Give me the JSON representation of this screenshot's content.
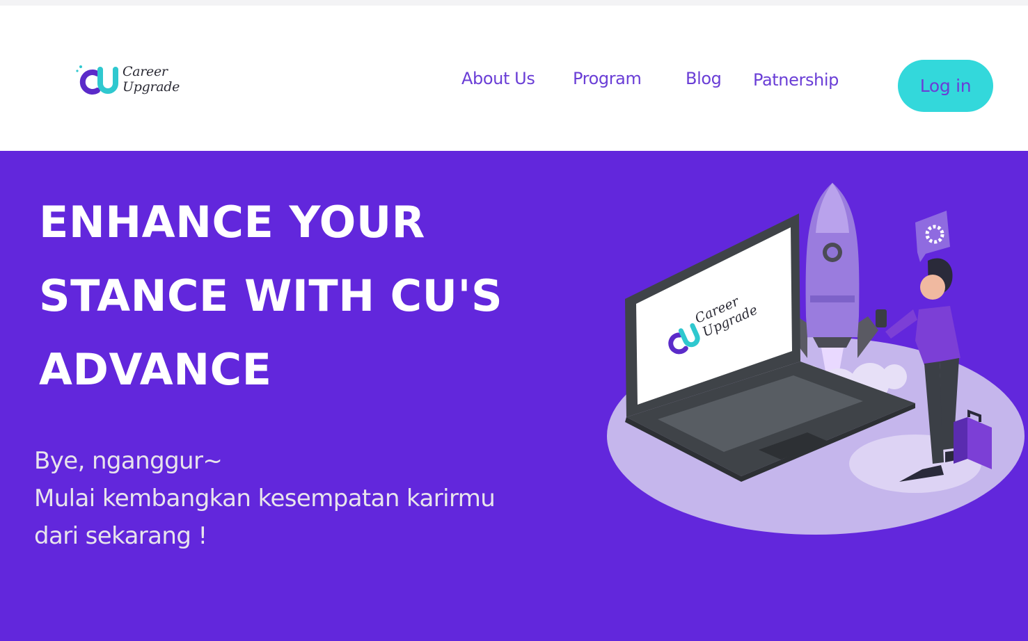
{
  "brand": {
    "logo_mark": "CU",
    "name_line1": "Career",
    "name_line2": "Upgrade"
  },
  "nav": {
    "items": [
      {
        "label": "About Us"
      },
      {
        "label": "Program"
      },
      {
        "label": "Blog"
      },
      {
        "label": "Patnership"
      }
    ],
    "login_label": "Log in"
  },
  "hero": {
    "headline_lines": [
      "ENHANCE YOUR",
      "STANCE WITH CU'S",
      "ADVANCE"
    ],
    "sub_lines": [
      "Bye, nganggur~",
      "Mulai kembangkan kesempatan karirmu",
      "dari sekarang !"
    ],
    "illustration": {
      "screen_brand_line1": "Career",
      "screen_brand_line2": "Upgrade"
    }
  },
  "colors": {
    "hero_bg": "#6227dc",
    "nav_text": "#6a3ed6",
    "login_bg": "#33d8db",
    "logo_teal": "#2fc8cf",
    "logo_purple": "#5b2bc9"
  }
}
